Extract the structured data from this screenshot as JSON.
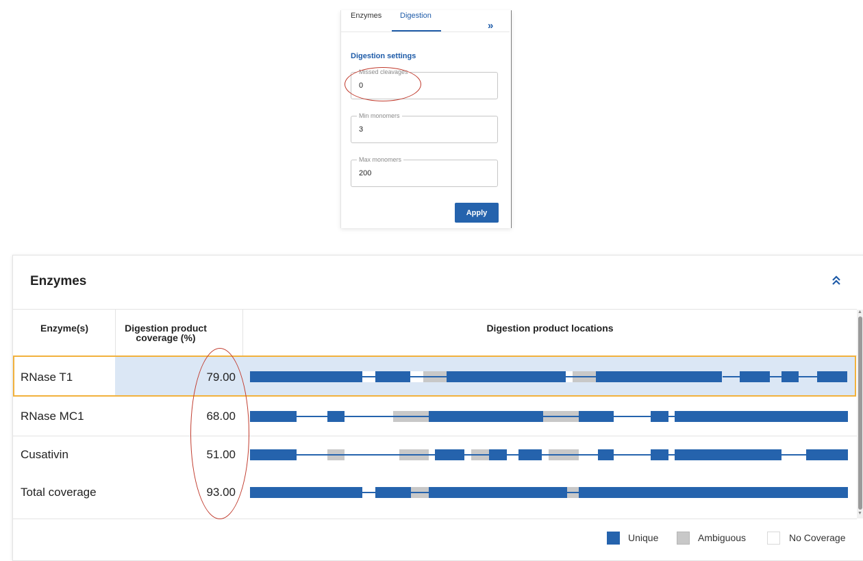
{
  "panel": {
    "tabs": [
      {
        "label": "Enzymes"
      },
      {
        "label": "Digestion"
      }
    ],
    "expand_icon": "double-chevron-right",
    "settings_title": "Digestion settings",
    "fields": [
      {
        "label": "Missed cleavages",
        "value": "0"
      },
      {
        "label": "Min monomers",
        "value": "3"
      },
      {
        "label": "Max monomers",
        "value": "200"
      }
    ],
    "apply_label": "Apply"
  },
  "enzymes_card": {
    "title": "Enzymes",
    "collapse_icon": "double-chevron-up",
    "headers": {
      "enzyme": "Enzyme(s)",
      "coverage_line1": "Digestion product",
      "coverage_line2": "coverage (%)",
      "locations": "Digestion product locations"
    },
    "rows": [
      {
        "label": "RNase T1",
        "coverage": "79.00",
        "selected": true
      },
      {
        "label": "RNase MC1",
        "coverage": "68.00",
        "selected": false
      },
      {
        "label": "Cusativin",
        "coverage": "51.00",
        "selected": false
      },
      {
        "label": "Total coverage",
        "coverage": "93.00",
        "selected": false
      }
    ],
    "legend": [
      {
        "label": "Unique",
        "color": "#2563ad"
      },
      {
        "label": "Ambiguous",
        "color": "#c8c8c8"
      },
      {
        "label": "No Coverage",
        "color": "#ffffff"
      }
    ]
  },
  "colors": {
    "unique": "#2563ad",
    "ambiguous": "#c8c8c8",
    "accent": "#1e5ba8",
    "selected_outline": "#f2b13b",
    "selected_fill": "#dbe7f5",
    "annotation": "#c0392b"
  }
}
